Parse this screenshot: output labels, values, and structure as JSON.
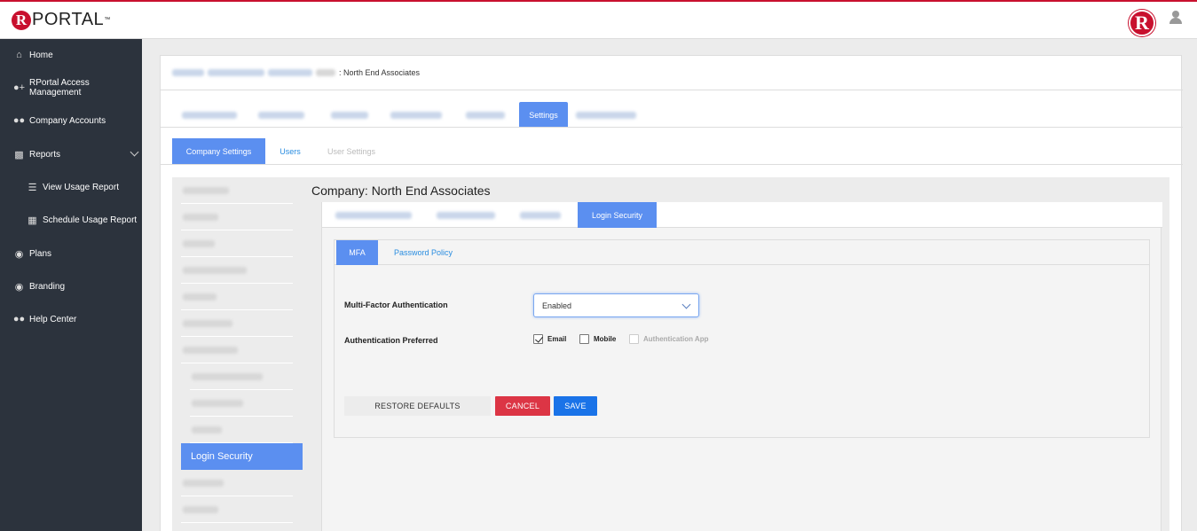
{
  "brand": {
    "logo_letter": "R",
    "logo_text": "PORTAL",
    "logo_tm": "™",
    "badge_letter": "R"
  },
  "sidebar": {
    "items": [
      {
        "label": "Home",
        "icon": "home-icon"
      },
      {
        "label": "RPortal Access Management",
        "icon": "user-plus-icon"
      },
      {
        "label": "Company Accounts",
        "icon": "users-icon"
      },
      {
        "label": "Reports",
        "icon": "bar-chart-icon"
      },
      {
        "label": "View Usage Report",
        "icon": "list-icon"
      },
      {
        "label": "Schedule Usage Report",
        "icon": "calendar-icon"
      },
      {
        "label": "Plans",
        "icon": "life-ring-icon"
      },
      {
        "label": "Branding",
        "icon": "life-ring-icon"
      },
      {
        "label": "Help Center",
        "icon": "users-icon"
      }
    ]
  },
  "breadcrumb": {
    "current": ": North End Associates"
  },
  "top_tabs": {
    "active": "Settings"
  },
  "settings_tabs": {
    "company_settings": "Company Settings",
    "users": "Users",
    "user_settings": "User Settings"
  },
  "menu": {
    "active": "Login Security"
  },
  "content": {
    "title": "Company: North End Associates",
    "active_tab": "Login Security",
    "mfa_tabs": {
      "mfa": "MFA",
      "password_policy": "Password Policy"
    },
    "mfa_label": "Multi-Factor Authentication",
    "mfa_value": "Enabled",
    "auth_label": "Authentication Preferred",
    "options": {
      "email": "Email",
      "mobile": "Mobile",
      "app": "Authentication App"
    },
    "buttons": {
      "restore": "RESTORE DEFAULTS",
      "cancel": "CANCEL",
      "save": "SAVE"
    }
  },
  "colors": {
    "accent": "#5b8ff0",
    "brand": "#c8102e",
    "sidebar_bg": "#2c333d",
    "danger": "#dc3545",
    "primary": "#1a73e8"
  }
}
